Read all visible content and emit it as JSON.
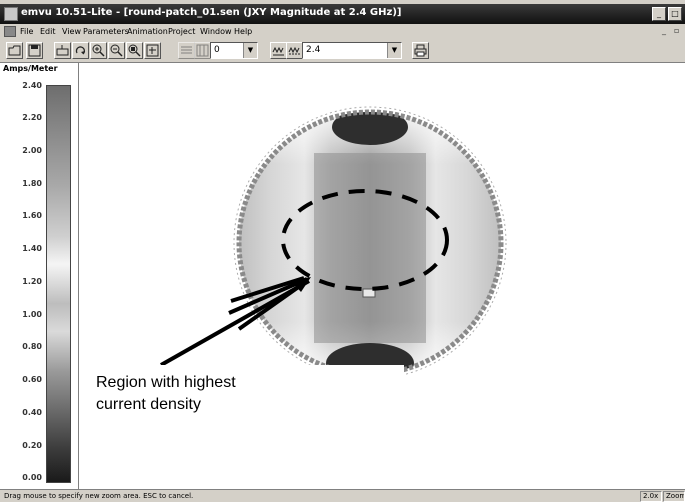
{
  "window": {
    "title": "emvu 10.51-Lite - [round-patch_01.sen (JXY Magnitude at 2.4 GHz)]",
    "buttons": {
      "minimize": "_",
      "maximize": "□"
    }
  },
  "menubar": {
    "items": [
      "File",
      "Edit",
      "View",
      "Parameters",
      "Animation",
      "Project",
      "Window",
      "Help"
    ],
    "mdi_minimize": "_",
    "mdi_restore": "▫"
  },
  "toolbar": {
    "index_value": "0",
    "frequency_value": "2.4",
    "icons": [
      "open-icon",
      "save-icon",
      "sensor-icon",
      "rotate-icon",
      "zoom-in-icon",
      "zoom-out-icon",
      "zoom-fit-icon",
      "fit-window-icon",
      "animation-icon",
      "print-icon"
    ]
  },
  "legend": {
    "unit": "Amps/Meter",
    "ticks": [
      "2.40",
      "2.20",
      "2.00",
      "1.80",
      "1.60",
      "1.40",
      "1.20",
      "1.00",
      "0.80",
      "0.60",
      "0.40",
      "0.20",
      "0.00"
    ]
  },
  "annotation": {
    "line1": "Region with highest",
    "line2": "current density"
  },
  "statusbar": {
    "message": "Drag mouse to specify new zoom area. ESC to cancel.",
    "zoom": "2.0x",
    "mode": "Zoom"
  },
  "colors": {
    "titlebar": "#1e1e1e",
    "chrome": "#d4d0c8",
    "plot_bg": "#ffffff"
  }
}
